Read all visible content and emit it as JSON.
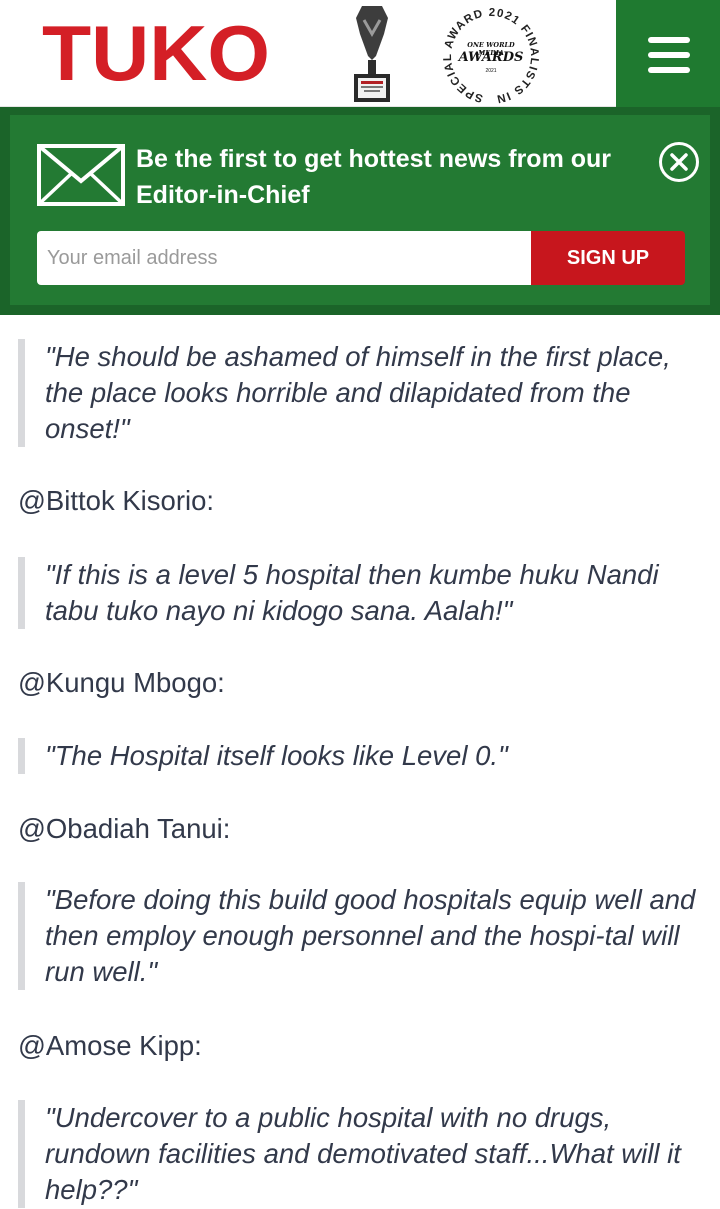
{
  "header": {
    "logo_text": "TUKO",
    "award_seal": {
      "top_arc": "SPECIAL AWARD 2021 FINALISTS IN",
      "line1": "ONE WORLD MEDIA",
      "line2": "AWARDS",
      "line3": "2021"
    },
    "menu_icon": "hamburger-menu-icon"
  },
  "newsletter": {
    "headline": "Be the first to get hottest news from our Editor-in-Chief",
    "email_placeholder": "Your email address",
    "signup_label": "SIGN UP",
    "colors": {
      "banner": "#237a33",
      "button": "#c7161d"
    }
  },
  "comments": [
    {
      "quote": "\"He should be ashamed of himself in the first place, the place looks horrible and dilapidated from the onset!\""
    },
    {
      "handle": "@Bittok Kisorio:",
      "quote": "\"If this is a level 5 hospital then kumbe huku Nandi tabu tuko nayo ni kidogo sana. Aalah!\""
    },
    {
      "handle": "@Kungu Mbogo:",
      "quote": "\"The Hospital itself looks like Level 0.\""
    },
    {
      "handle": "@Obadiah Tanui:",
      "quote": "\"Before doing this build good hospitals equip well and then employ enough personnel and the hospi-tal will run well.\""
    },
    {
      "handle": "@Amose Kipp:",
      "quote": "\"Undercover to a public hospital with no drugs, rundown facilities and demotivated staff...What will it help??\""
    }
  ]
}
